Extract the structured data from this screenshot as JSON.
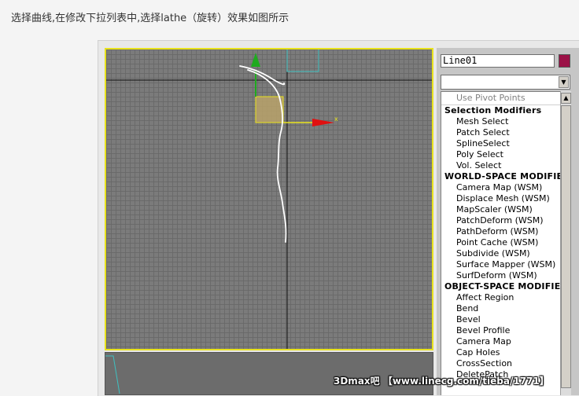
{
  "caption": "选择曲线,在修改下拉列表中,选择lathe（旋转）效果如图所示",
  "object_name": "Line01",
  "object_color": "#9b1147",
  "modifier_dropdown_value": "",
  "modifier_list": {
    "top_item": "Use Pivot Points",
    "sections": [
      {
        "header": "Selection Modifiers",
        "items": [
          "Mesh Select",
          "Patch Select",
          "SplineSelect",
          "Poly Select",
          "Vol. Select"
        ]
      },
      {
        "header": "WORLD-SPACE MODIFIE",
        "items": [
          "Camera Map (WSM)",
          "Displace Mesh (WSM)",
          "MapScaler (WSM)",
          "PatchDeform (WSM)",
          "PathDeform (WSM)",
          "Point Cache (WSM)",
          "Subdivide (WSM)",
          "Surface Mapper (WSM)",
          "SurfDeform (WSM)"
        ]
      },
      {
        "header": "OBJECT-SPACE MODIFIE",
        "items": [
          "Affect Region",
          "Bend",
          "Bevel",
          "Bevel Profile",
          "Camera Map",
          "Cap Holes",
          "CrossSection",
          "DeletePatch"
        ]
      }
    ]
  },
  "watermark": "3Dmax吧 【www.linecg.com/tieba/1771】",
  "colors": {
    "viewport_border_active": "#e8e21c",
    "axis_y": "#1faa1f",
    "axis_x": "#e01010",
    "spline": "#ffffff",
    "gizmo": "#c8b070"
  }
}
